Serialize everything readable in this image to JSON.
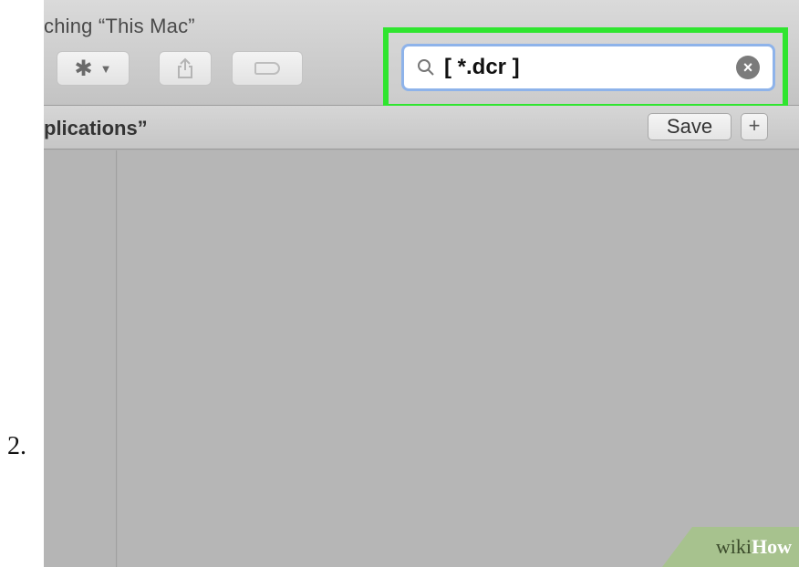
{
  "step": {
    "number": "2."
  },
  "window": {
    "title": "ching “This Mac”"
  },
  "toolbar": {
    "action_icon": "gear-icon",
    "action_chevron": "⌄",
    "share_icon": "share-icon",
    "tag_icon": "tag-icon"
  },
  "search": {
    "value": "[ *.dcr ]",
    "highlight_color": "#2fe52f"
  },
  "scope": {
    "label": "plications”",
    "save_label": "Save",
    "add_label": "+"
  },
  "watermark": {
    "wiki": "wiki",
    "how": "How"
  }
}
